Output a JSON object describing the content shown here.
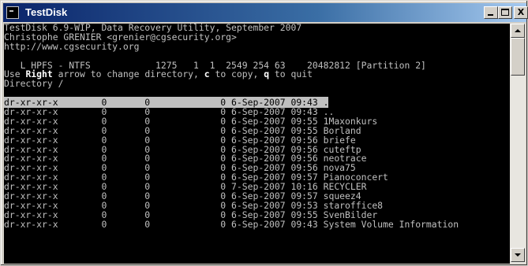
{
  "window": {
    "title": "TestDisk",
    "icon": "console-icon",
    "buttons": [
      "minimize-icon",
      "maximize-icon",
      "close-icon"
    ],
    "close_glyph": "X"
  },
  "console": {
    "header_lines": [
      "TestDisk 6.9-WIP, Data Recovery Utility, September 2007",
      "Christophe GRENIER <grenier@cgsecurity.org>",
      "http://www.cgsecurity.org"
    ],
    "partition_line": "   L HPFS - NTFS            1275   1  1  2549 254 63    20482812 [Partition 2]",
    "instructions": {
      "prefix": "Use ",
      "key_right": "Right",
      "mid1": " arrow to change directory, ",
      "key_c": "c",
      "mid2": " to copy, ",
      "key_q": "q",
      "suffix": " to quit"
    },
    "directory_line": "Directory /",
    "selected_index": 0,
    "entries": [
      {
        "perm": "dr-xr-xr-x",
        "uid": "0",
        "gid": "0",
        "size": "0",
        "date": "6-Sep-2007",
        "time": "09:43",
        "name": "."
      },
      {
        "perm": "dr-xr-xr-x",
        "uid": "0",
        "gid": "0",
        "size": "0",
        "date": "6-Sep-2007",
        "time": "09:43",
        "name": ".."
      },
      {
        "perm": "dr-xr-xr-x",
        "uid": "0",
        "gid": "0",
        "size": "0",
        "date": "6-Sep-2007",
        "time": "09:55",
        "name": "1Maxonkurs"
      },
      {
        "perm": "dr-xr-xr-x",
        "uid": "0",
        "gid": "0",
        "size": "0",
        "date": "6-Sep-2007",
        "time": "09:55",
        "name": "Borland"
      },
      {
        "perm": "dr-xr-xr-x",
        "uid": "0",
        "gid": "0",
        "size": "0",
        "date": "6-Sep-2007",
        "time": "09:56",
        "name": "briefe"
      },
      {
        "perm": "dr-xr-xr-x",
        "uid": "0",
        "gid": "0",
        "size": "0",
        "date": "6-Sep-2007",
        "time": "09:56",
        "name": "cuteftp"
      },
      {
        "perm": "dr-xr-xr-x",
        "uid": "0",
        "gid": "0",
        "size": "0",
        "date": "6-Sep-2007",
        "time": "09:56",
        "name": "neotrace"
      },
      {
        "perm": "dr-xr-xr-x",
        "uid": "0",
        "gid": "0",
        "size": "0",
        "date": "6-Sep-2007",
        "time": "09:56",
        "name": "nova75"
      },
      {
        "perm": "dr-xr-xr-x",
        "uid": "0",
        "gid": "0",
        "size": "0",
        "date": "6-Sep-2007",
        "time": "09:57",
        "name": "Pianoconcert"
      },
      {
        "perm": "dr-xr-xr-x",
        "uid": "0",
        "gid": "0",
        "size": "0",
        "date": "7-Sep-2007",
        "time": "10:16",
        "name": "RECYCLER"
      },
      {
        "perm": "dr-xr-xr-x",
        "uid": "0",
        "gid": "0",
        "size": "0",
        "date": "6-Sep-2007",
        "time": "09:57",
        "name": "squeez4"
      },
      {
        "perm": "dr-xr-xr-x",
        "uid": "0",
        "gid": "0",
        "size": "0",
        "date": "6-Sep-2007",
        "time": "09:53",
        "name": "staroffice8"
      },
      {
        "perm": "dr-xr-xr-x",
        "uid": "0",
        "gid": "0",
        "size": "0",
        "date": "6-Sep-2007",
        "time": "09:55",
        "name": "SvenBilder"
      },
      {
        "perm": "dr-xr-xr-x",
        "uid": "0",
        "gid": "0",
        "size": "0",
        "date": "6-Sep-2007",
        "time": "09:43",
        "name": "System Volume Information"
      }
    ]
  },
  "colors": {
    "console_bg": "#000000",
    "console_fg": "#c0c0c0",
    "highlight_bg": "#c0c0c0",
    "titlebar_start": "#0a246a",
    "titlebar_end": "#a6caf0"
  }
}
